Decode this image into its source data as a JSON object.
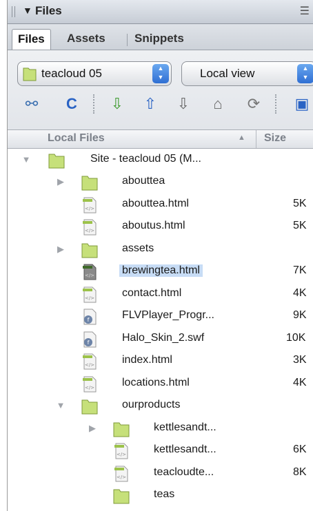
{
  "panel": {
    "title": "Files",
    "collapse_icon": "triangle-down-icon",
    "options_icon": "panel-options-icon"
  },
  "tabs": [
    {
      "label": "Files",
      "active": true
    },
    {
      "label": "Assets",
      "active": false
    },
    {
      "label": "Snippets",
      "active": false
    }
  ],
  "site_select": {
    "value": "teacloud 05",
    "icon": "folder-icon"
  },
  "view_select": {
    "value": "Local view"
  },
  "toolbar": {
    "icons": [
      "connect-icon",
      "refresh-icon",
      "get-files-icon",
      "put-files-icon",
      "check-out-icon",
      "check-in-icon",
      "synchronize-icon",
      "expand-icon"
    ]
  },
  "columns": {
    "local_files": "Local Files",
    "size": "Size"
  },
  "tree": [
    {
      "name": "Site - teacloud 05 (M...",
      "size": "",
      "type": "folder",
      "expanded": true
    },
    {
      "name": "abouttea",
      "size": "",
      "type": "folder",
      "expanded": false
    },
    {
      "name": "abouttea.html",
      "size": "5K",
      "type": "html"
    },
    {
      "name": "aboutus.html",
      "size": "5K",
      "type": "html"
    },
    {
      "name": "assets",
      "size": "",
      "type": "folder",
      "expanded": false
    },
    {
      "name": "brewingtea.html",
      "size": "7K",
      "type": "html",
      "selected": true
    },
    {
      "name": "contact.html",
      "size": "4K",
      "type": "html"
    },
    {
      "name": "FLVPlayer_Progr...",
      "size": "9K",
      "type": "swf"
    },
    {
      "name": "Halo_Skin_2.swf",
      "size": "10K",
      "type": "swf"
    },
    {
      "name": "index.html",
      "size": "3K",
      "type": "html"
    },
    {
      "name": "locations.html",
      "size": "4K",
      "type": "html"
    },
    {
      "name": "ourproducts",
      "size": "",
      "type": "folder",
      "expanded": true
    },
    {
      "name": "kettlesandt...",
      "size": "",
      "type": "folder",
      "expanded": false
    },
    {
      "name": "kettlesandt...",
      "size": "6K",
      "type": "html"
    },
    {
      "name": "teacloudte...",
      "size": "8K",
      "type": "html"
    },
    {
      "name": "teas",
      "size": "",
      "type": "folder"
    }
  ],
  "colors": {
    "selection": "#c7dcf5",
    "folder": "#c6e07a",
    "accent": "#2f6fd3"
  }
}
